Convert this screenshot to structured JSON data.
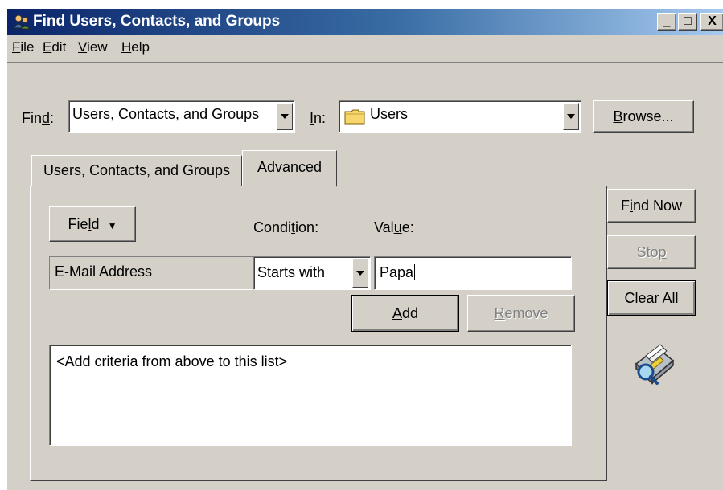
{
  "window": {
    "title": "Find Users, Contacts, and Groups"
  },
  "caption_buttons": {
    "minimize": "_",
    "maximize": "□",
    "close": "X"
  },
  "menu": {
    "items": [
      {
        "pre": "",
        "key": "F",
        "post": "ile"
      },
      {
        "pre": "",
        "key": "E",
        "post": "dit"
      },
      {
        "pre": "",
        "key": "V",
        "post": "iew"
      },
      {
        "pre": "",
        "key": "H",
        "post": "elp"
      }
    ]
  },
  "find": {
    "label_pre": "Fin",
    "label_key": "d",
    "label_post": ":",
    "value": "Users, Contacts, and Groups"
  },
  "in": {
    "label_pre": "",
    "label_key": "I",
    "label_post": "n:",
    "value": "Users"
  },
  "browse": {
    "key": "B",
    "post": "rowse..."
  },
  "tabs": {
    "tab1": "Users, Contacts, and Groups",
    "tab2": "Advanced"
  },
  "criteria": {
    "field_button_pre": "Fie",
    "field_button_key": "l",
    "field_button_post": "d",
    "condition_label_pre": "Condi",
    "condition_label_key": "t",
    "condition_label_post": "ion:",
    "value_label_pre": "Val",
    "value_label_key": "u",
    "value_label_post": "e:",
    "field_value": "E-Mail Address",
    "condition_value": "Starts with",
    "value_text": "Papa",
    "add_key": "A",
    "add_post": "dd",
    "remove_key": "R",
    "remove_post": "emove",
    "list_placeholder": "<Add criteria from above to this list>"
  },
  "side": {
    "find_now_pre": "F",
    "find_now_key": "i",
    "find_now_post": "nd Now",
    "stop_pre": "Sto",
    "stop_key": "p",
    "clear_key": "C",
    "clear_post": "lear All"
  }
}
